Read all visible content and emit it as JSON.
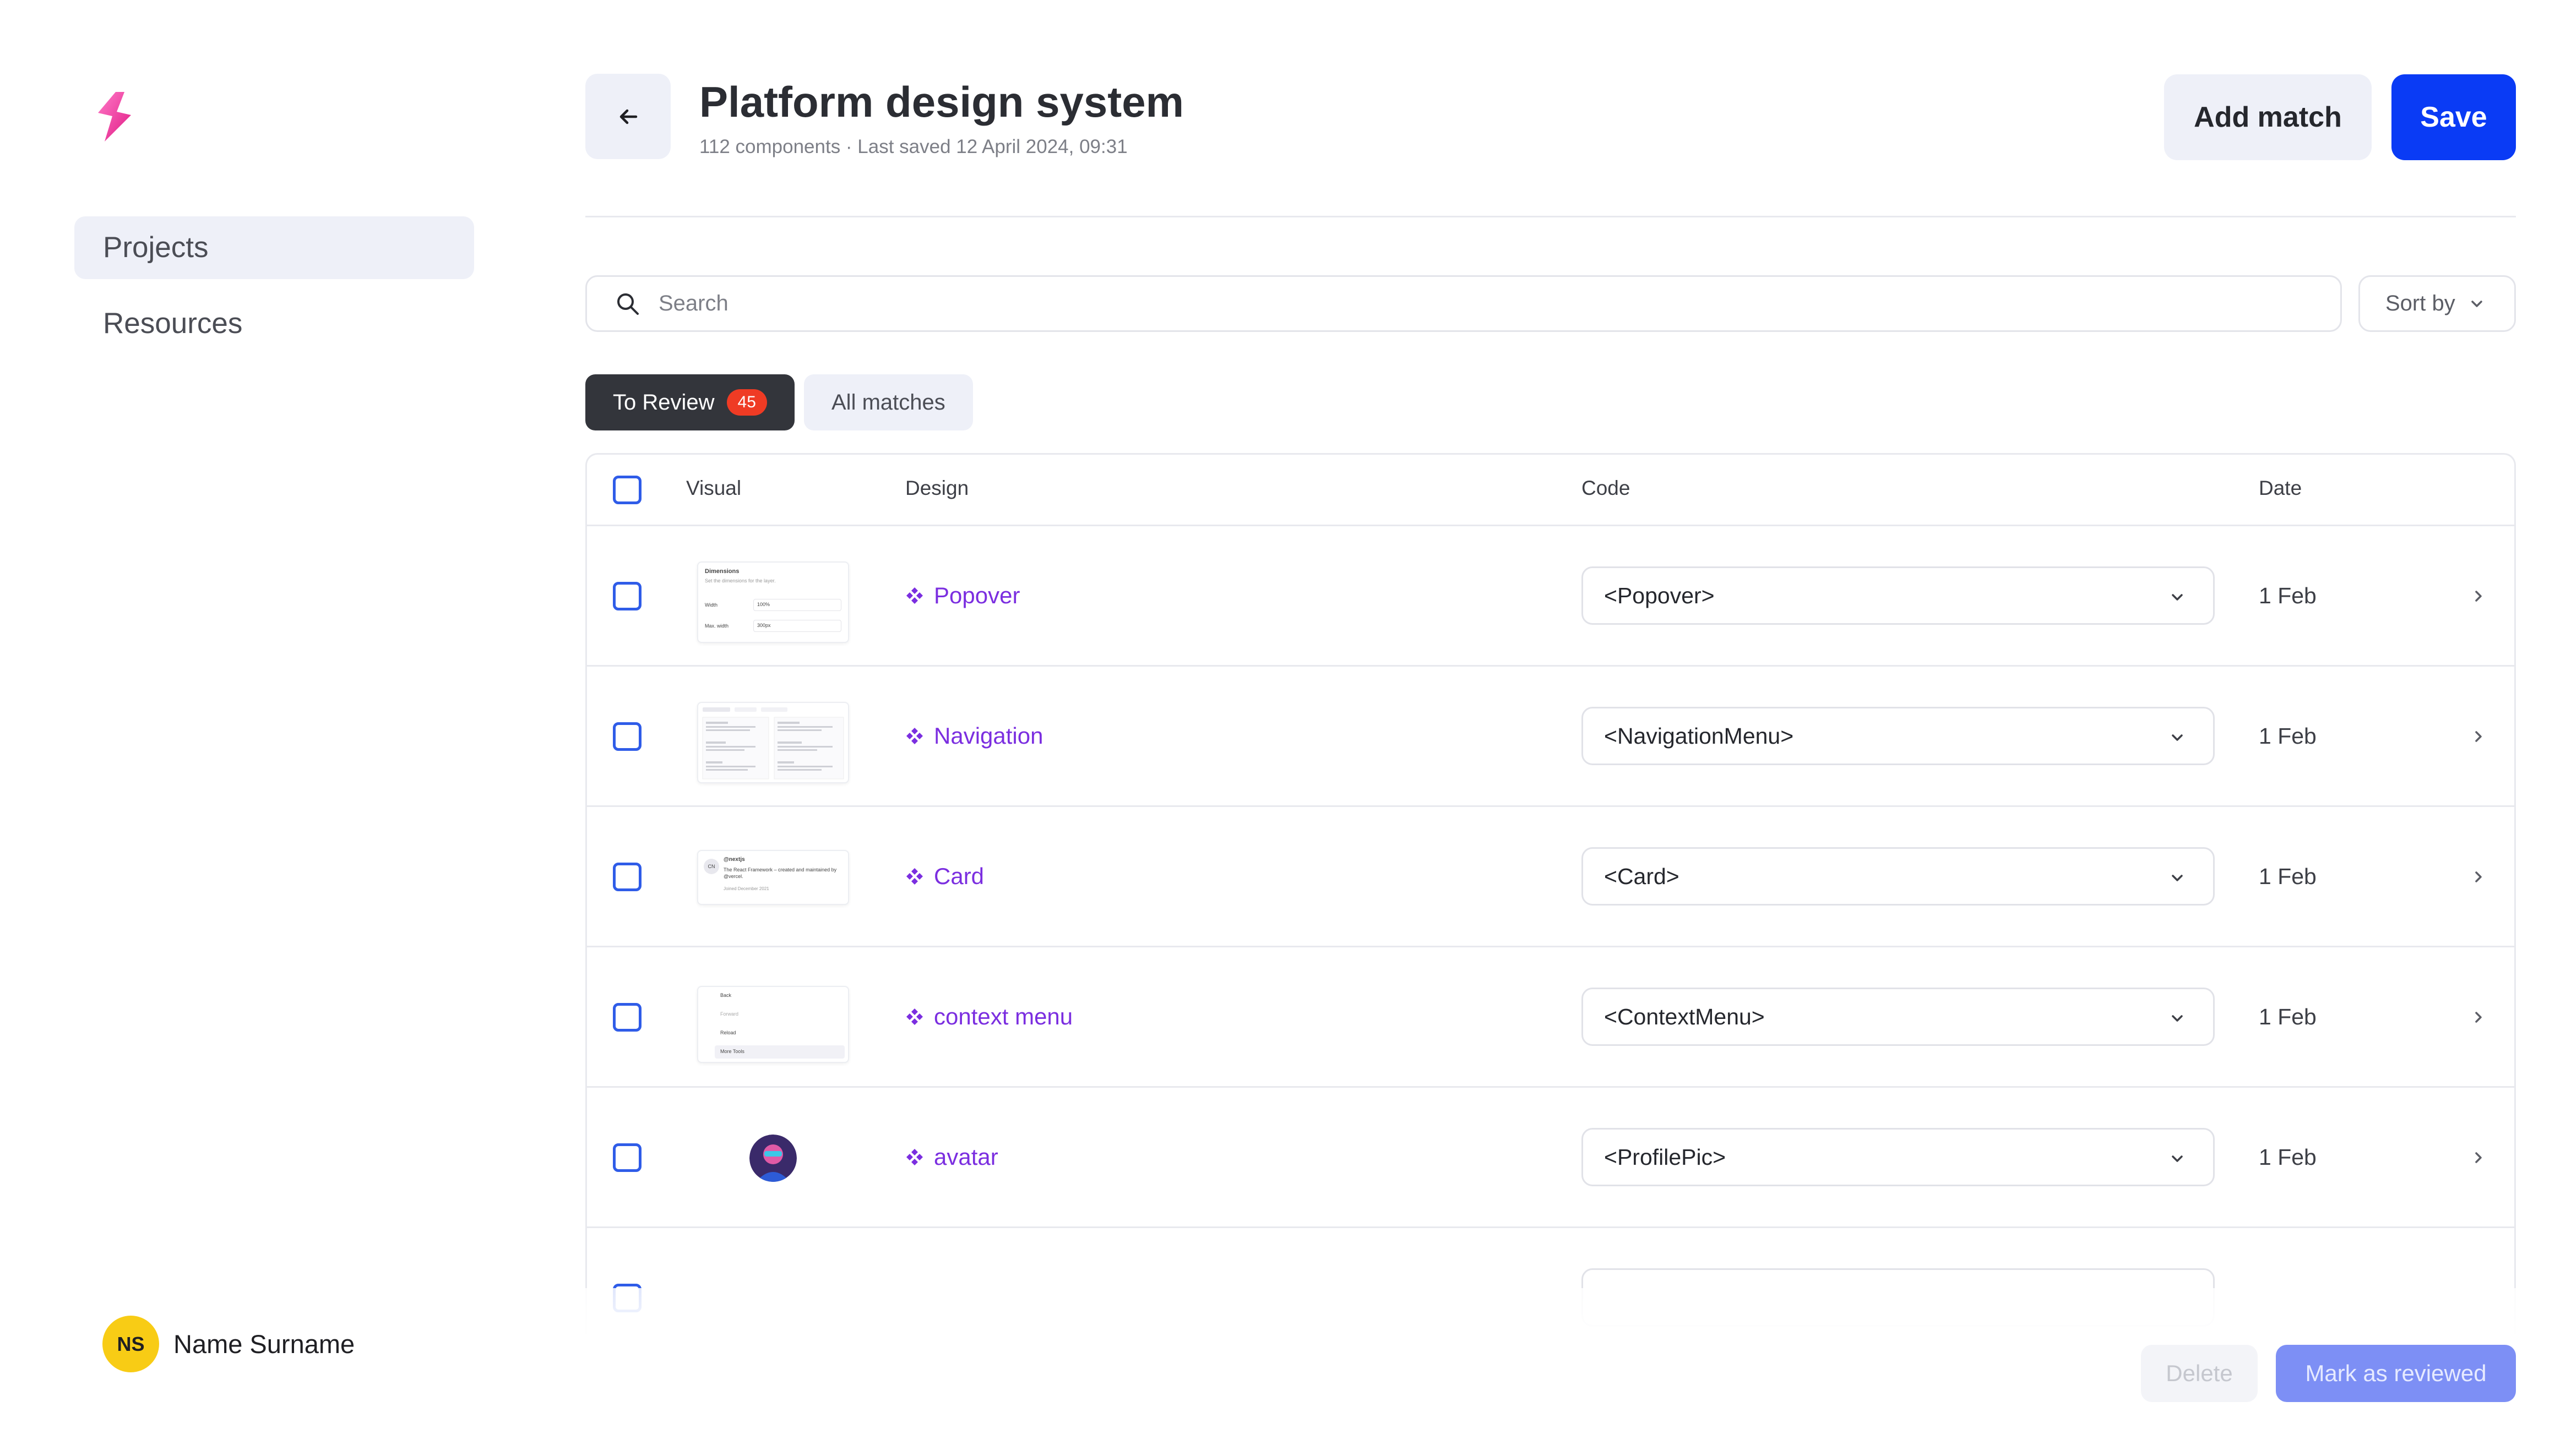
{
  "sidebar": {
    "logo_icon": "bolt-logo-icon",
    "items": [
      {
        "label": "Projects",
        "active": true
      },
      {
        "label": "Resources",
        "active": false
      }
    ],
    "user": {
      "initials": "NS",
      "name": "Name Surname"
    }
  },
  "header": {
    "back_icon": "arrow-left-icon",
    "title": "Platform design system",
    "subtitle": "112 components · Last saved 12 April 2024, 09:31",
    "add_match_label": "Add match",
    "save_label": "Save"
  },
  "search": {
    "placeholder": "Search",
    "value": "",
    "icon": "search-icon"
  },
  "sort": {
    "label": "Sort by",
    "icon": "chevron-down-icon"
  },
  "tabs": [
    {
      "label": "To Review",
      "badge": "45",
      "active": true
    },
    {
      "label": "All matches",
      "active": false
    }
  ],
  "table": {
    "columns": [
      "Visual",
      "Design",
      "Code",
      "Date"
    ],
    "rows": [
      {
        "design": "Popover",
        "code": "<Popover>",
        "date": "1 Feb",
        "visual": "popover-thumbnail"
      },
      {
        "design": "Navigation",
        "code": "<NavigationMenu>",
        "date": "1 Feb",
        "visual": "navigation-thumbnail"
      },
      {
        "design": "Card",
        "code": "<Card>",
        "date": "1 Feb",
        "visual": "card-thumbnail"
      },
      {
        "design": "context menu",
        "code": "<ContextMenu>",
        "date": "1 Feb",
        "visual": "context-menu-thumbnail"
      },
      {
        "design": "avatar",
        "code": "<ProfilePic>",
        "date": "1 Feb",
        "visual": "avatar-thumbnail"
      }
    ]
  },
  "thumbnails": {
    "popover": {
      "title": "Dimensions",
      "desc": "Set the dimensions for the layer.",
      "width_label": "Width",
      "width_value": "100%",
      "max_label": "Max. width",
      "max_value": "300px"
    },
    "card": {
      "initials": "CN",
      "handle": "@nextjs",
      "text": "The React Framework – created and maintained by @vercel.",
      "joined": "Joined December 2021"
    },
    "context_menu": {
      "items": [
        "Back",
        "Forward",
        "Reload",
        "More Tools"
      ]
    }
  },
  "footer": {
    "delete_label": "Delete",
    "review_label": "Mark as reviewed"
  },
  "colors": {
    "accent": "#0a3bf5",
    "design_link": "#7b2ee0",
    "badge": "#ef3b24",
    "avatar": "#f8cc15"
  }
}
